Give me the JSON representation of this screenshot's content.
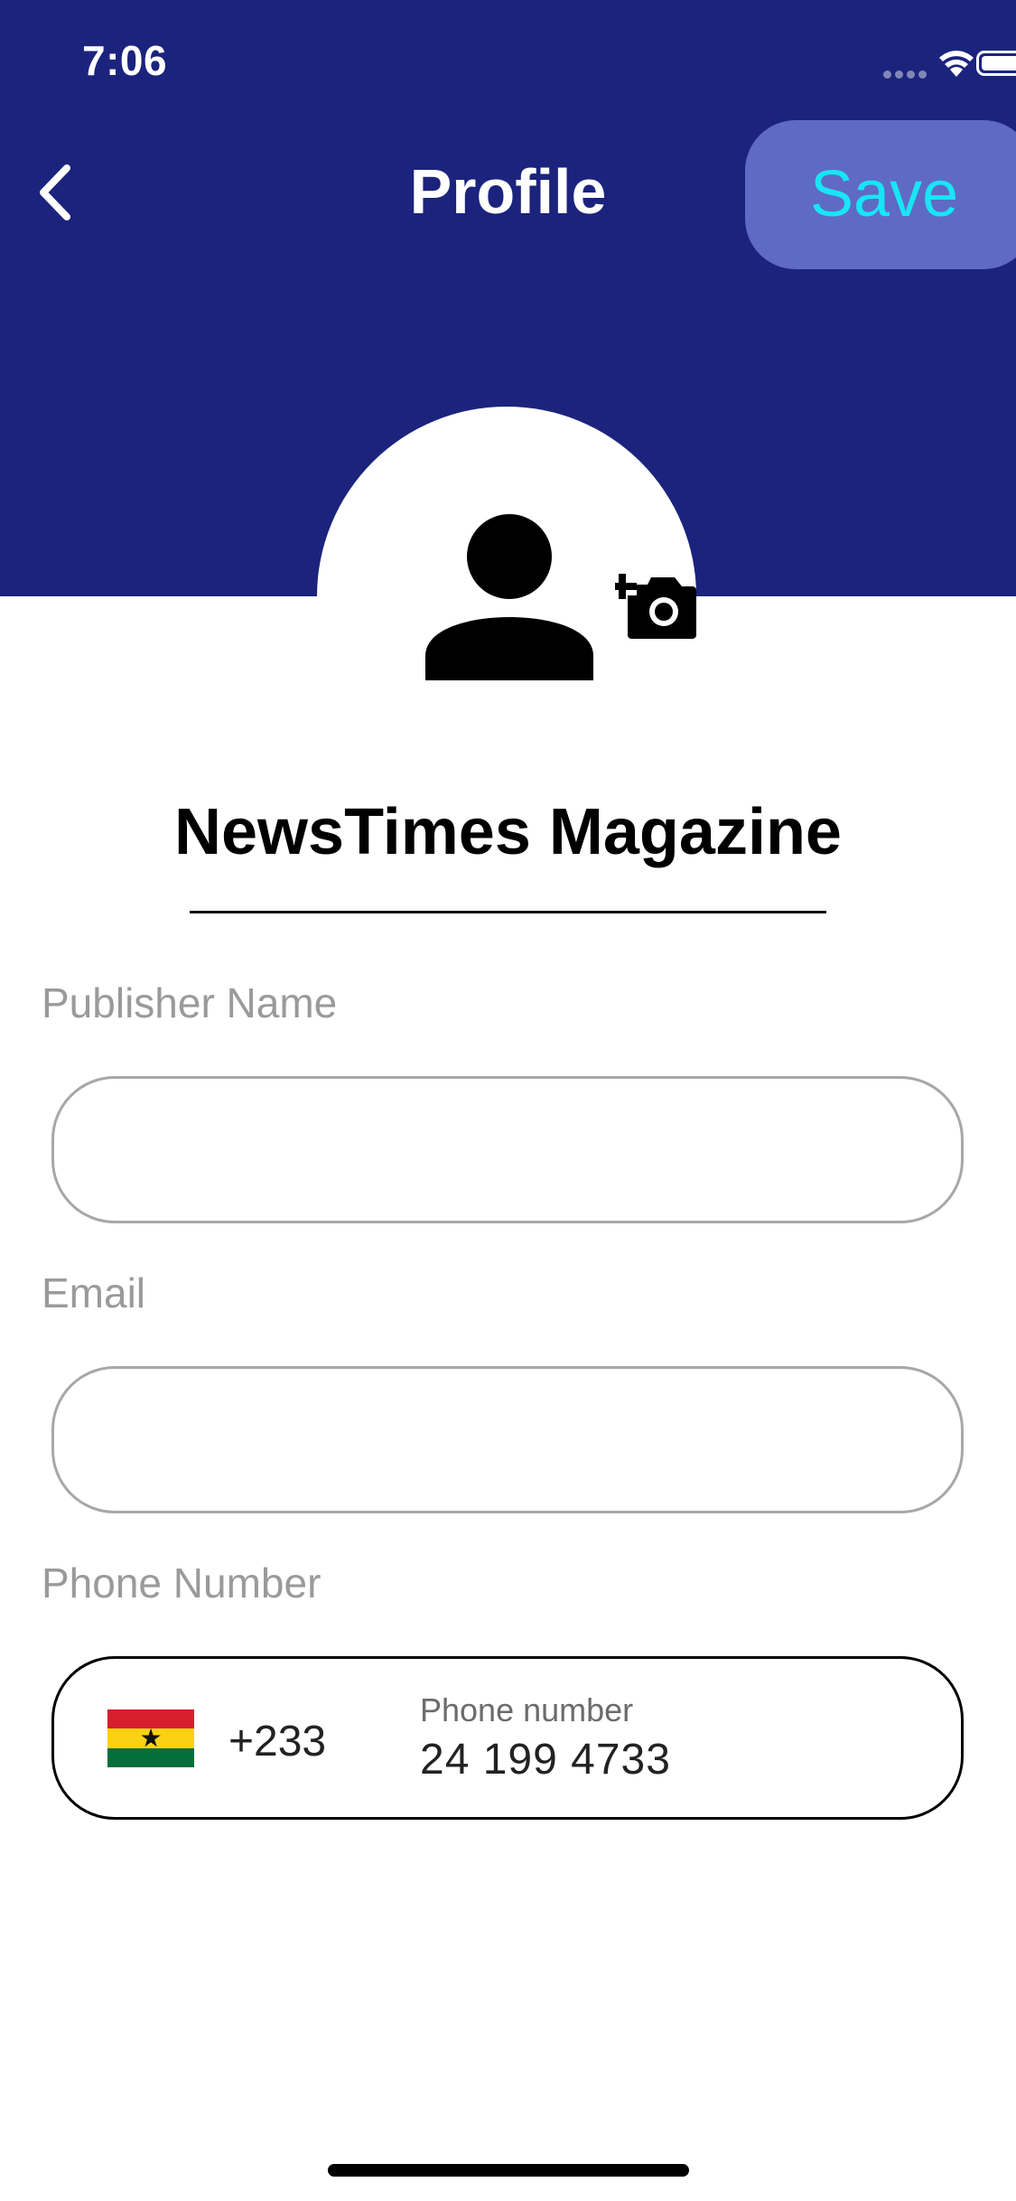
{
  "status_bar": {
    "time": "7:06"
  },
  "header": {
    "title": "Profile",
    "save_label": "Save",
    "back_icon": "chevron-left-icon"
  },
  "profile": {
    "name": "NewsTimes Magazine",
    "avatar_icon": "person-icon",
    "camera_icon": "add-photo-icon"
  },
  "form": {
    "publisher_name": {
      "label": "Publisher Name",
      "value": ""
    },
    "email": {
      "label": "Email",
      "value": ""
    },
    "phone": {
      "label": "Phone Number",
      "dial_code": "+233",
      "inner_label": "Phone number",
      "value": "24 199 4733",
      "flag": "ghana-flag"
    }
  },
  "colors": {
    "header_bg": "#1b237d",
    "save_button_bg": "#5f6ac4",
    "save_text": "#18e5f5"
  }
}
